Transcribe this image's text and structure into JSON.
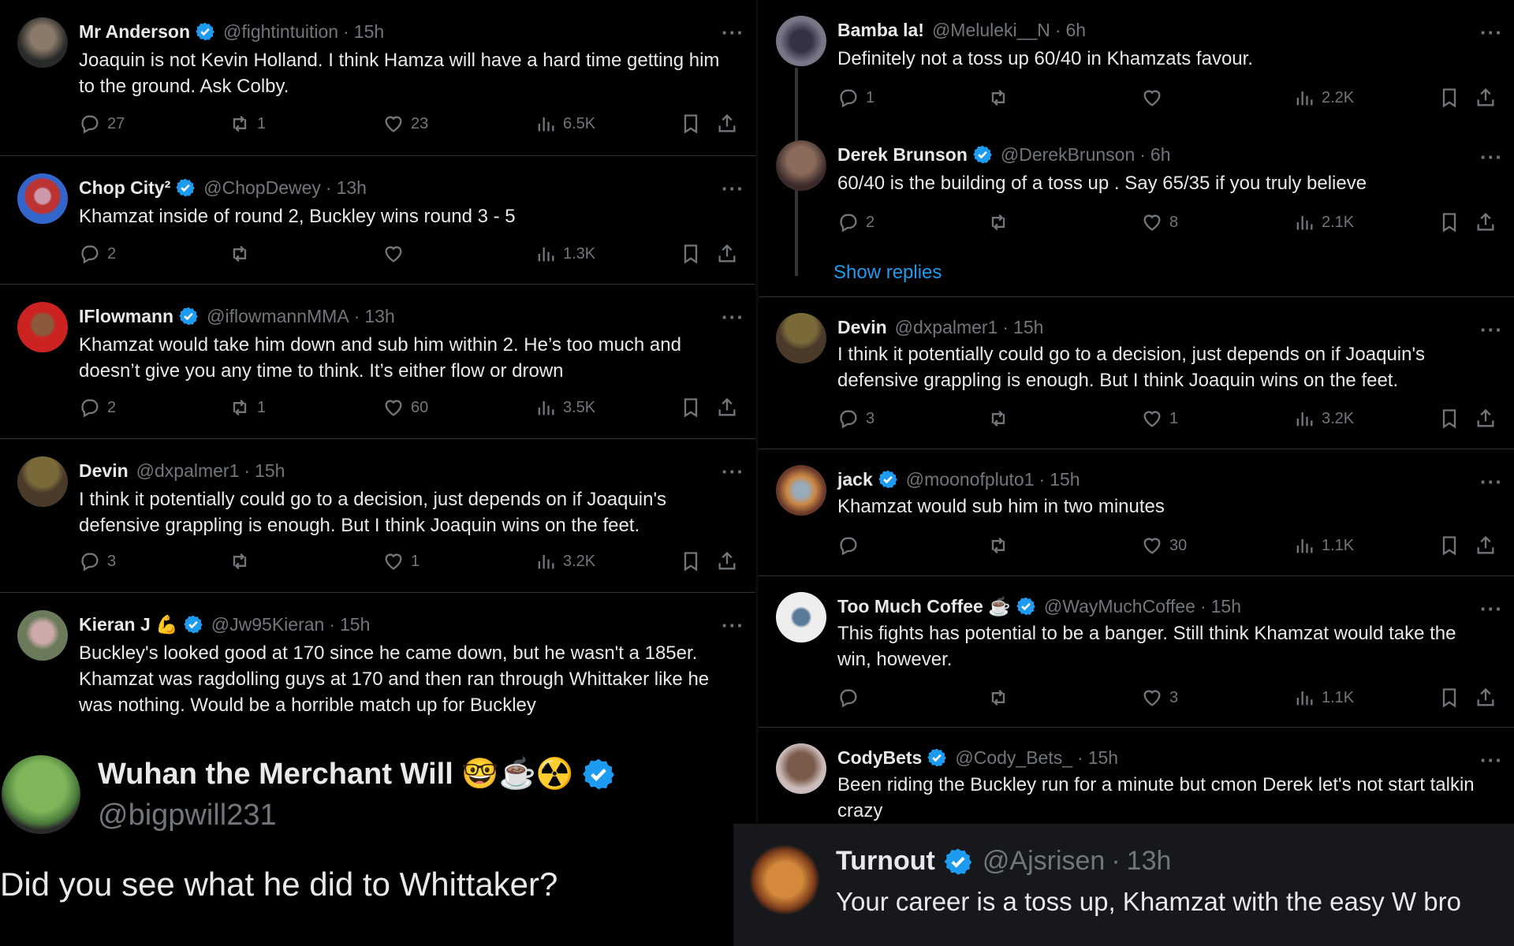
{
  "left_tweets": [
    {
      "name": "Mr Anderson",
      "verified": true,
      "handle": "@fightintuition",
      "time": "15h",
      "text": "Joaquin is not Kevin Holland. I think Hamza will have a hard time getting him to the ground. Ask Colby.",
      "replies": "27",
      "retweets": "1",
      "likes": "23",
      "views": "6.5K"
    },
    {
      "name": "Chop City²",
      "verified": true,
      "handle": "@ChopDewey",
      "time": "13h",
      "text": "Khamzat inside of round 2, Buckley wins round 3 - 5",
      "replies": "2",
      "retweets": "",
      "likes": "",
      "views": "1.3K"
    },
    {
      "name": "IFlowmann",
      "verified": true,
      "handle": "@iflowmannMMA",
      "time": "13h",
      "text": "Khamzat would take him down and sub him within 2. He’s too much and doesn’t give you any time to think. It’s either flow or drown",
      "replies": "2",
      "retweets": "1",
      "likes": "60",
      "views": "3.5K"
    },
    {
      "name": "Devin",
      "verified": false,
      "handle": "@dxpalmer1",
      "time": "15h",
      "text": "I think it potentially could go to a decision, just depends on if Joaquin's defensive grappling is enough. But I think Joaquin wins on the feet.",
      "replies": "3",
      "retweets": "",
      "likes": "1",
      "views": "3.2K"
    },
    {
      "name": "Kieran J 💪",
      "verified": true,
      "handle": "@Jw95Kieran",
      "time": "15h",
      "text": "Buckley's looked good at 170 since he came down, but he wasn't a 185er. Khamzat was ragdolling guys at 170 and then ran through Whittaker like he was nothing. Would be a horrible match up for Buckley"
    }
  ],
  "right_tweets": [
    {
      "name": "Bamba la!",
      "verified": false,
      "handle": "@Meluleki__N",
      "time": "6h",
      "text": "Definitely not a toss up 60/40 in Khamzats favour.",
      "replies": "1",
      "retweets": "",
      "likes": "",
      "views": "2.2K"
    },
    {
      "name": "Derek Brunson",
      "verified": true,
      "handle": "@DerekBrunson",
      "time": "6h",
      "text": "60/40 is the building of a toss up . Say 65/35 if you truly believe",
      "replies": "2",
      "retweets": "",
      "likes": "8",
      "views": "2.1K"
    },
    {
      "name": "Devin",
      "verified": false,
      "handle": "@dxpalmer1",
      "time": "15h",
      "text": "I think it potentially could go to a decision, just depends on if Joaquin's defensive grappling is enough. But I think Joaquin wins on the feet.",
      "replies": "3",
      "retweets": "",
      "likes": "1",
      "views": "3.2K"
    },
    {
      "name": "jack",
      "verified": true,
      "handle": "@moonofpluto1",
      "time": "15h",
      "text": "Khamzat would sub him in two minutes",
      "replies": "",
      "retweets": "",
      "likes": "30",
      "views": "1.1K"
    },
    {
      "name": "Too Much Coffee ☕",
      "verified": true,
      "handle": "@WayMuchCoffee",
      "time": "15h",
      "text": "This fights has potential to be a banger. Still think Khamzat would take the win, however.",
      "replies": "",
      "retweets": "",
      "likes": "3",
      "views": "1.1K"
    },
    {
      "name": "CodyBets",
      "verified": true,
      "handle": "@Cody_Bets_",
      "time": "15h",
      "text": "Been riding the Buckley run for a minute but cmon Derek let's not start talkin crazy"
    }
  ],
  "show_replies": "Show replies",
  "big_left": {
    "name": "Wuhan the Merchant Will 🤓☕☢️",
    "handle": "@bigpwill231",
    "text": "Did you see what he did to Whittaker?"
  },
  "big_right": {
    "name": "Turnout",
    "handle": "@Ajsrisen",
    "time": "13h",
    "text": "Your career is a toss up, Khamzat with the easy W bro"
  },
  "colors": {
    "accent": "#1d9bf0",
    "muted": "#71767b",
    "text": "#e7e9ea",
    "border": "#2f3336",
    "background": "#000000"
  },
  "icons": [
    "reply-icon",
    "retweet-icon",
    "like-icon",
    "views-icon",
    "bookmark-icon",
    "share-icon",
    "verified-badge-icon",
    "more-options-icon"
  ]
}
